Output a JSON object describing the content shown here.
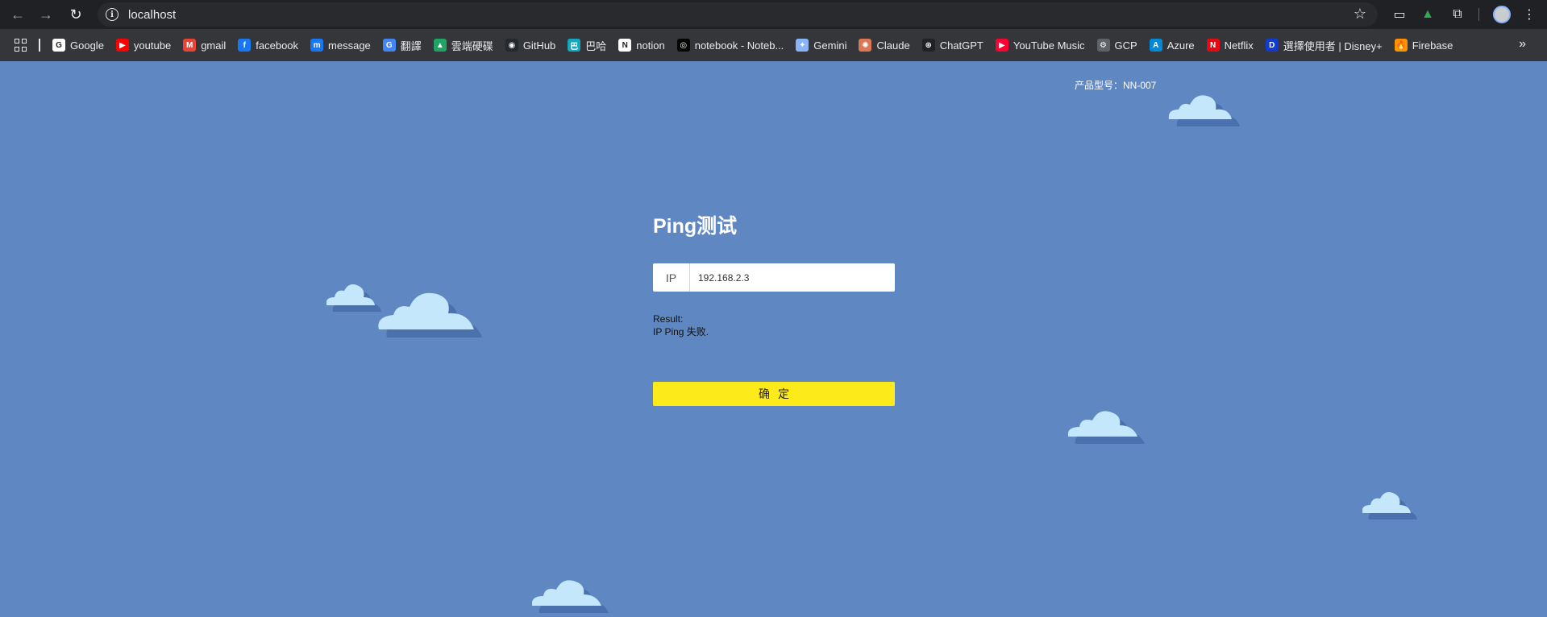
{
  "browser": {
    "url": "localhost",
    "bookmarks": [
      {
        "label": "Google",
        "color": "#ffffff",
        "glyph": "G"
      },
      {
        "label": "youtube",
        "color": "#ff0000",
        "glyph": "▶"
      },
      {
        "label": "gmail",
        "color": "#ea4335",
        "glyph": "M"
      },
      {
        "label": "facebook",
        "color": "#1877f2",
        "glyph": "f"
      },
      {
        "label": "message",
        "color": "#1877f2",
        "glyph": "m"
      },
      {
        "label": "翻譯",
        "color": "#4285f4",
        "glyph": "G"
      },
      {
        "label": "雲端硬碟",
        "color": "#1fa463",
        "glyph": "▲"
      },
      {
        "label": "GitHub",
        "color": "#24292e",
        "glyph": "◉"
      },
      {
        "label": "巴哈",
        "color": "#13a8bf",
        "glyph": "巴"
      },
      {
        "label": "notion",
        "color": "#ffffff",
        "glyph": "N"
      },
      {
        "label": "notebook - Noteb...",
        "color": "#000000",
        "glyph": "◎"
      },
      {
        "label": "Gemini",
        "color": "#8ab4f8",
        "glyph": "✦"
      },
      {
        "label": "Claude",
        "color": "#d97757",
        "glyph": "✺"
      },
      {
        "label": "ChatGPT",
        "color": "#202124",
        "glyph": "⊛"
      },
      {
        "label": "YouTube Music",
        "color": "#ff0033",
        "glyph": "▶"
      },
      {
        "label": "GCP",
        "color": "#5f6368",
        "glyph": "⚙"
      },
      {
        "label": "Azure",
        "color": "#0089d6",
        "glyph": "A"
      },
      {
        "label": "Netflix",
        "color": "#e50914",
        "glyph": "N"
      },
      {
        "label": "選擇使用者 | Disney+",
        "color": "#113ccf",
        "glyph": "D"
      },
      {
        "label": "Firebase",
        "color": "#ff9100",
        "glyph": "🔥"
      }
    ]
  },
  "page": {
    "product_model": "产品型号：NN-007",
    "title": "Ping测试",
    "ip_label": "IP",
    "ip_value": "192.168.2.3",
    "result_label": "Result:",
    "result_text": "IP Ping 失败.",
    "confirm_label": "确定"
  },
  "colors": {
    "background": "#5f87c2",
    "button": "#fcea1a",
    "cloud": "#c5e7fb",
    "cloud_shadow": "#4a71ad"
  }
}
